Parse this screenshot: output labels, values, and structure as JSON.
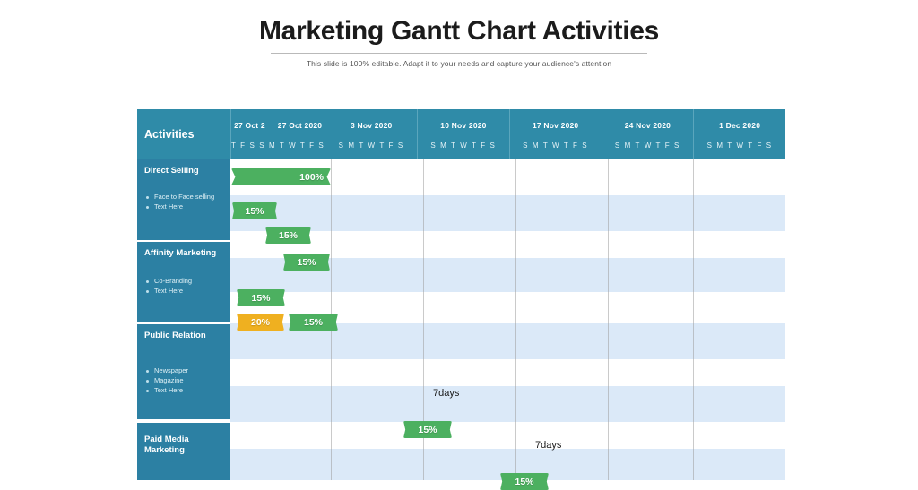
{
  "title": "Marketing Gantt Chart Activities",
  "subtitle": "This slide is 100% editable. Adapt it to your needs and capture your audience's attention",
  "colors": {
    "header_teal": "#2f8ba8",
    "sidebar_teal": "#2c80a3",
    "band_blue": "#dbe9f8",
    "bar_green": "#4cb060",
    "bar_orange": "#efb020"
  },
  "header": {
    "activities_label": "Activities",
    "columns": [
      {
        "dates": [
          "27 Oct 2",
          "27 Oct 2020"
        ],
        "days": "T F S S M T W T F S"
      },
      {
        "dates": [
          "3  Nov 2020"
        ],
        "days": "S M T W T F S"
      },
      {
        "dates": [
          "10 Nov 2020"
        ],
        "days": "S M T W T F S"
      },
      {
        "dates": [
          "17 Nov 2020"
        ],
        "days": "S M T W T F S"
      },
      {
        "dates": [
          "24 Nov  2020"
        ],
        "days": "S M T W T F S"
      },
      {
        "dates": [
          "1 Dec  2020"
        ],
        "days": "S M T W T F S"
      }
    ]
  },
  "activities": [
    {
      "title": "Direct Selling",
      "bullets": [
        "Face to Face selling",
        "Text Here"
      ]
    },
    {
      "title": "Affinity Marketing",
      "bullets": [
        "Co-Branding",
        "Text Here"
      ]
    },
    {
      "title": "Public Relation",
      "bullets": [
        "Newspaper",
        "Magazine",
        "Text Here"
      ]
    },
    {
      "title": "Paid Media Marketing",
      "bullets": []
    }
  ],
  "bars": [
    {
      "label": "100%",
      "color": "green",
      "align": "right"
    },
    {
      "label": "15%",
      "color": "green",
      "align": "center"
    },
    {
      "label": "15%",
      "color": "green",
      "align": "center"
    },
    {
      "label": "15%",
      "color": "green",
      "align": "center"
    },
    {
      "label": "15%",
      "color": "green",
      "align": "center"
    },
    {
      "label": "20%",
      "color": "orange",
      "align": "center"
    },
    {
      "label": "15%",
      "color": "green",
      "align": "center"
    },
    {
      "label": "15%",
      "color": "green",
      "align": "center"
    },
    {
      "label": "15%",
      "color": "green",
      "align": "center"
    }
  ],
  "durations": [
    {
      "label": "7days"
    },
    {
      "label": "7days"
    }
  ],
  "chart_data": {
    "type": "bar",
    "title": "Marketing Gantt Chart Activities",
    "xlabel": "",
    "ylabel": "",
    "categories": [
      "Direct Selling",
      "Face to Face selling",
      "Text Here",
      "Affinity Marketing",
      "Co-Branding",
      "Text Here",
      "Public Relation",
      "Paid Media Marketing"
    ],
    "timeline_columns": [
      "27 Oct 2 / 27 Oct 2020",
      "3 Nov 2020",
      "10 Nov 2020",
      "17 Nov 2020",
      "24 Nov 2020",
      "1 Dec 2020"
    ],
    "tasks": [
      {
        "row": "Direct Selling",
        "label": "100%",
        "value": 100,
        "color": "#4cb060",
        "start_week": 0,
        "span_weeks": 1.0
      },
      {
        "row": "Face to Face selling",
        "label": "15%",
        "value": 15,
        "color": "#4cb060",
        "start_week": 0,
        "span_weeks": 0.45
      },
      {
        "row": "Text Here",
        "label": "15%",
        "value": 15,
        "color": "#4cb060",
        "start_week": 0.4,
        "span_weeks": 0.45
      },
      {
        "row": "Affinity Marketing",
        "label": "15%",
        "value": 15,
        "color": "#4cb060",
        "start_week": 0.6,
        "span_weeks": 0.45
      },
      {
        "row": "Co-Branding",
        "label": "15%",
        "value": 15,
        "color": "#4cb060",
        "start_week": 0,
        "span_weeks": 0.45
      },
      {
        "row": "Text Here (orange)",
        "label": "20%",
        "value": 20,
        "color": "#efb020",
        "start_week": 0,
        "span_weeks": 0.42
      },
      {
        "row": "Text Here (green)",
        "label": "15%",
        "value": 15,
        "color": "#4cb060",
        "start_week": 0.45,
        "span_weeks": 0.42
      },
      {
        "row": "Public Relation",
        "label": "15%",
        "value": 15,
        "color": "#4cb060",
        "start_week": 2.6,
        "span_weeks": 0.45,
        "duration": "7days"
      },
      {
        "row": "Paid Media Marketing",
        "label": "15%",
        "value": 15,
        "color": "#4cb060",
        "start_week": 3.6,
        "span_weeks": 0.45,
        "duration": "7days"
      }
    ],
    "grid": true,
    "legend": "none"
  }
}
